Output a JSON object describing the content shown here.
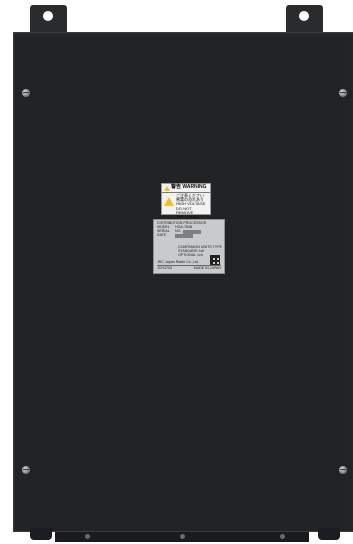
{
  "warning_label": {
    "title": "警告 WARNING",
    "jp_line1": "ご注意ください",
    "jp_line2": "感電の恐れあり",
    "line1": "HIGH VOLTAGE",
    "line2": "DO NOT REMOVE",
    "line3": "THE COVER"
  },
  "nameplate": {
    "line1": "DISTRIBUTION PROCESSOR",
    "model_key": "MODEL",
    "model_val": "HOA-7848",
    "serial_key": "SERIAL",
    "serial_val": "NO.",
    "date_key": "DATE",
    "conf1": "COMPANION UNITS TYPE",
    "conf2": "STANDARD 1ch",
    "conf3": "OPTIONAL 1ch",
    "maker": "JRC Japan Radio Co.,Ltd.",
    "foot_left": "JCH4703",
    "foot_right": "MADE IN JAPAN"
  }
}
